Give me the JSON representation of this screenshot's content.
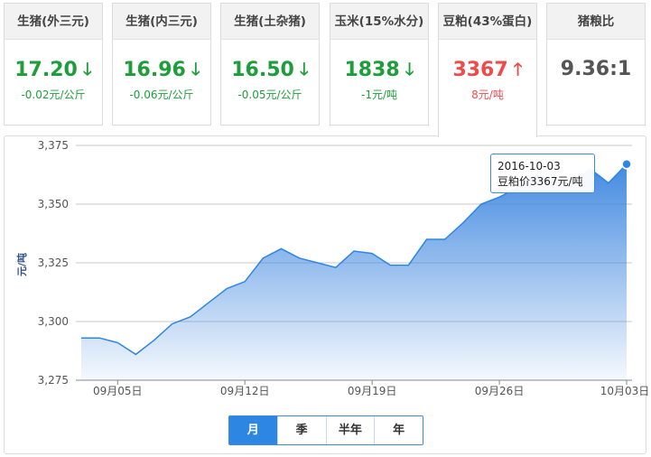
{
  "cards": [
    {
      "label": "生猪(外三元)",
      "value": "17.20",
      "change": "-0.02元/公斤",
      "direction": "down",
      "arrow": "🡓"
    },
    {
      "label": "生猪(内三元)",
      "value": "16.96",
      "change": "-0.06元/公斤",
      "direction": "down",
      "arrow": "🡓"
    },
    {
      "label": "生猪(土杂猪)",
      "value": "16.50",
      "change": "-0.05元/公斤",
      "direction": "down",
      "arrow": "🡓"
    },
    {
      "label": "玉米(15%水分)",
      "value": "1838",
      "change": "-1元/吨",
      "direction": "down",
      "arrow": "🡓"
    },
    {
      "label": "豆粕(43%蛋白)",
      "value": "3367",
      "change": "8元/吨",
      "direction": "up",
      "arrow": "🡑",
      "active": true
    },
    {
      "label": "猪粮比",
      "value": "9.36:1",
      "change": "",
      "direction": "flat",
      "arrow": ""
    }
  ],
  "colors": {
    "down": "#1e9e3a",
    "up": "#ee4b4b",
    "series": "#2e86e3",
    "accent": "#3c89e6"
  },
  "tooltip": {
    "date": "2016-10-03",
    "text": "豆粕价3367元/吨"
  },
  "range_tabs": [
    {
      "label": "月",
      "active": true
    },
    {
      "label": "季",
      "active": false
    },
    {
      "label": "半年",
      "active": false
    },
    {
      "label": "年",
      "active": false
    }
  ],
  "chart_data": {
    "type": "area",
    "ylabel": "元/吨",
    "ylim": [
      3275,
      3375
    ],
    "yticks": [
      "3,275",
      "3,300",
      "3,325",
      "3,350",
      "3,375"
    ],
    "ytick_values": [
      3275,
      3300,
      3325,
      3350,
      3375
    ],
    "xticks": [
      {
        "label": "09月05日",
        "day": 5
      },
      {
        "label": "09月12日",
        "day": 12
      },
      {
        "label": "09月19日",
        "day": 19
      },
      {
        "label": "09月26日",
        "day": 26
      },
      {
        "label": "10月03日",
        "day": 33
      }
    ],
    "grid": true,
    "series": [
      {
        "x": [
          3,
          4,
          5,
          6,
          7,
          8,
          9,
          10,
          11,
          12,
          13,
          14,
          15,
          16,
          17,
          18,
          19,
          20,
          21,
          22,
          23,
          24,
          25,
          26,
          27,
          28,
          29,
          30,
          31,
          32,
          33
        ],
        "values": [
          3293,
          3293,
          3291,
          3286,
          3292,
          3299,
          3302,
          3308,
          3314,
          3317,
          3327,
          3331,
          3327,
          3325,
          3323,
          3330,
          3329,
          3324,
          3324,
          3335,
          3335,
          3342,
          3350,
          3353,
          3357,
          3362,
          3361,
          3358,
          3365,
          3359,
          3367
        ]
      }
    ]
  }
}
